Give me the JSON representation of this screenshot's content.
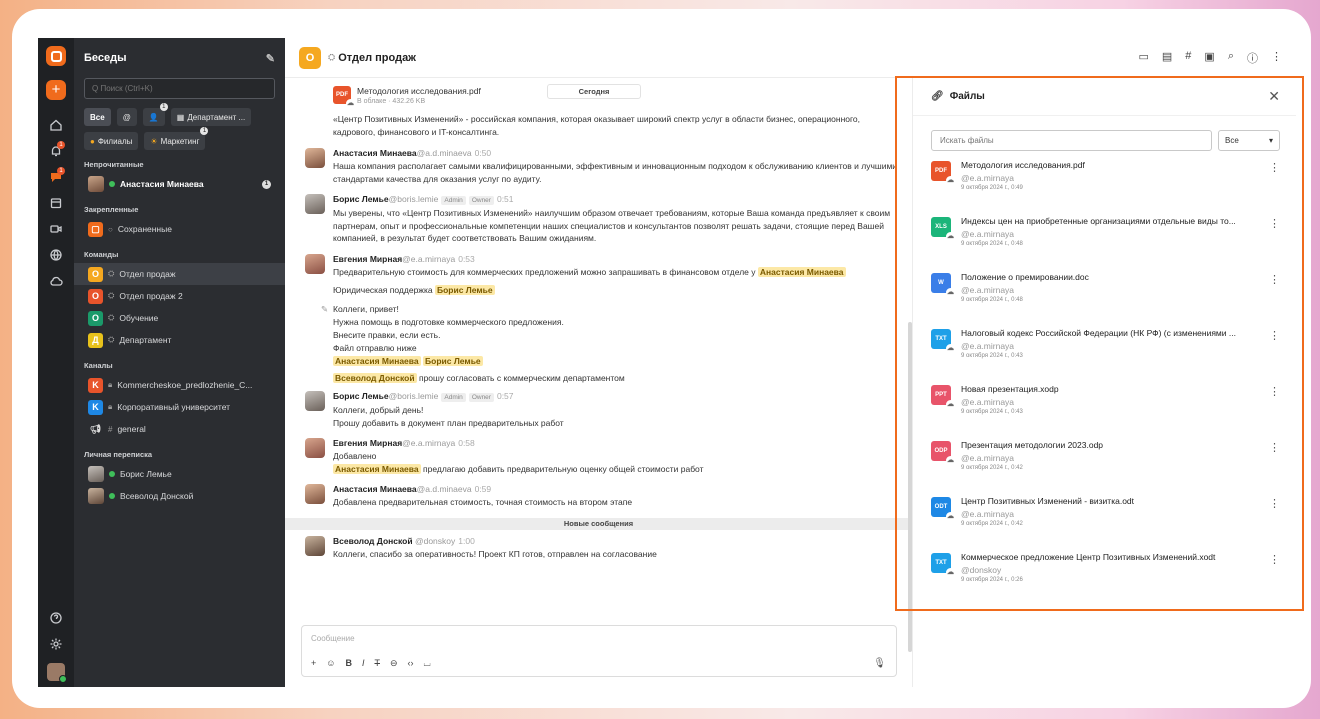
{
  "sidebar": {
    "title": "Беседы",
    "search_placeholder": "Q Поиск (Ctrl+K)",
    "chips": [
      {
        "label": "Все",
        "badge": ""
      },
      {
        "label": "@",
        "badge": ""
      },
      {
        "label": "8",
        "badge": "1"
      },
      {
        "label": "Департамент ...",
        "badge": ""
      },
      {
        "label": "Филиалы",
        "badge": ""
      },
      {
        "label": "Маркетинг",
        "badge": "1"
      }
    ],
    "sections": {
      "unread": "Непрочитанные",
      "pinned": "Закрепленные",
      "teams": "Команды",
      "channels": "Каналы",
      "personal": "Личная переписка"
    },
    "unread_item": {
      "name": "Анастасия Минаева",
      "count": "1"
    },
    "pinned_item": {
      "letter": "",
      "name": "Сохраненные"
    },
    "teams": [
      {
        "letter": "О",
        "name": "Отдел продаж",
        "color": "#f5a820"
      },
      {
        "letter": "О",
        "name": "Отдел продаж 2",
        "color": "#e8542b"
      },
      {
        "letter": "О",
        "name": "Обучение",
        "color": "#1b9a6a"
      },
      {
        "letter": "Д",
        "name": "Департамент",
        "color": "#e8c21b"
      }
    ],
    "channels": [
      {
        "letter": "K",
        "name": "Kommercheskoe_predlozhenie_C...",
        "color": "#e8542b"
      },
      {
        "letter": "K",
        "name": "Корпоративный университет",
        "color": "#1e88e5"
      },
      {
        "letter": "",
        "name": "general",
        "color": ""
      }
    ],
    "personal": [
      {
        "name": "Борис Лемье"
      },
      {
        "name": "Всеволод Донской"
      }
    ]
  },
  "topbar": {
    "letter": "О",
    "title": "Отдел продаж"
  },
  "conversation": {
    "today_label": "Сегодня",
    "attachment": {
      "name": "Методология исследования.pdf",
      "meta": "В облаке · 432.26 KB"
    },
    "intro_text": "«Центр Позитивных Изменений» - российская компания, которая оказывает широкий спектр услуг в области бизнес, операционного, кадрового, финансового и IT-консалтинга.",
    "messages": [
      {
        "name": "Анастасия Минаева",
        "user": "@a.d.minaeva",
        "time": "0:50",
        "text": "Наша компания располагает самыми квалифицированными, эффективным и инновационным подходом к обслуживанию клиентов и лучшими стандартами качества для оказания услуг по аудиту."
      },
      {
        "name": "Борис Лемье",
        "user": "@boris.lemie",
        "tag1": "Admin",
        "tag2": "Owner",
        "time": "0:51",
        "text": "Мы уверены, что «Центр Позитивных Изменений» наилучшим образом отвечает требованиям, которые Ваша команда предъявляет к своим партнерам, опыт и профессиональные компетенции наших специалистов и консультантов позволят решать задачи, стоящие перед Вашей компанией, в результат будет соответствовать Вашим ожиданиям."
      },
      {
        "name": "Евгения Мирная",
        "user": "@e.a.mirnaya",
        "time": "0:53",
        "text": "Предварительную стоимость для коммерческих предложений можно запрашивать в финансовом отделе у",
        "mention": "Анастасия Минаева"
      }
    ],
    "legal_line": "Юридическая поддержка",
    "legal_mention": "Борис Лемье",
    "edited_lines": [
      "Коллеги, привет!",
      "Нужна помощь в подготовке коммерческого предложения.",
      "Внесите правки, если есть.",
      "Файл отправлю ниже"
    ],
    "edited_mentions": [
      "Анастасия Минаева",
      "Борис Лемье"
    ],
    "approve_mention": "Всеволод Донской",
    "approve_text": "прошу согласовать с коммерческим департаментом",
    "messages2": [
      {
        "name": "Борис Лемье",
        "user": "@boris.lemie",
        "tag1": "Admin",
        "tag2": "Owner",
        "time": "0:57",
        "line1": "Коллеги, добрый день!",
        "line2": "Прошу добавить в документ план предварительных работ"
      },
      {
        "name": "Евгения Мирная",
        "user": "@e.a.mirnaya",
        "time": "0:58",
        "line1": "Добавлено",
        "mention": "Анастасия Минаева",
        "line2": "предлагаю добавить предварительную оценку общей стоимости работ"
      },
      {
        "name": "Анастасия Минаева",
        "user": "@a.d.minaeva",
        "time": "0:59",
        "line1": "Добавлена предварительная стоимость, точная стоимость на втором этапе"
      }
    ],
    "new_messages_label": "Новые сообщения",
    "last_message": {
      "name": "Всеволод Донской",
      "user": "@donskoy",
      "time": "1:00",
      "text": "Коллеги, спасибо за оперативность! Проект КП готов, отправлен на согласование"
    },
    "composer_placeholder": "Сообщение"
  },
  "files_panel": {
    "title": "Файлы",
    "search_placeholder": "Искать файлы",
    "filter": "Все",
    "files": [
      {
        "name": "Методология исследования.pdf",
        "user": "@e.a.mirnaya",
        "date": "9 октября 2024 г., 0:49",
        "color": "#e8542b",
        "type": "PDF"
      },
      {
        "name": "Индексы цен на приобретенные организациями отдельные виды то...",
        "user": "@e.a.mirnaya",
        "date": "9 октября 2024 г., 0:48",
        "color": "#1bb57a",
        "type": "XLS"
      },
      {
        "name": "Положение о премировании.doc",
        "user": "@e.a.mirnaya",
        "date": "9 октября 2024 г., 0:48",
        "color": "#3a7ee8",
        "type": "W"
      },
      {
        "name": "Налоговый кодекс Российской Федерации (НК РФ) (с изменениями ...",
        "user": "@e.a.mirnaya",
        "date": "9 октября 2024 г., 0:43",
        "color": "#1ea0e8",
        "type": "TXT"
      },
      {
        "name": "Новая презентация.xodp",
        "user": "@e.a.mirnaya",
        "date": "9 октября 2024 г., 0:43",
        "color": "#e8546a",
        "type": "PPT"
      },
      {
        "name": "Презентация методологии 2023.odp",
        "user": "@e.a.mirnaya",
        "date": "9 октября 2024 г., 0:42",
        "color": "#e8546a",
        "type": "ODP"
      },
      {
        "name": "Центр Позитивных Изменений - визитка.odt",
        "user": "@e.a.mirnaya",
        "date": "9 октября 2024 г., 0:42",
        "color": "#1e88e5",
        "type": "ODT"
      },
      {
        "name": "Коммерческое предложение Центр Позитивных Изменений.xodt",
        "user": "@donskoy",
        "date": "9 октября 2024 г., 0:26",
        "color": "#1ea0e8",
        "type": "TXT"
      }
    ]
  },
  "colors": {
    "accent": "#f06b1c",
    "mention_bg": "#fce8a6"
  }
}
